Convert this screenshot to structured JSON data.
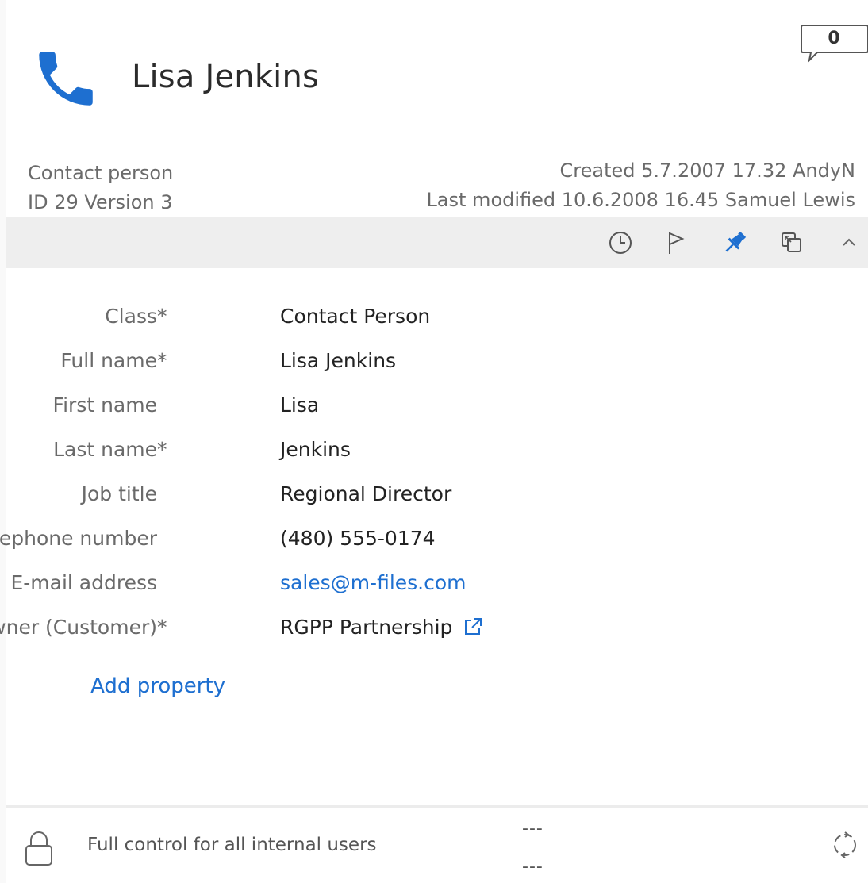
{
  "object": {
    "title": "Lisa Jenkins",
    "type_icon": "phone-icon",
    "type_label": "Contact person",
    "id_version": "ID 29  Version 3",
    "created": "Created 5.7.2007 17.32 AndyN",
    "modified": "Last modified 10.6.2008 16.45 Samuel Lewis",
    "comment_count": "0",
    "accent_color": "#1e6fd0"
  },
  "toolbar": {
    "icons": [
      "history-icon",
      "workflow-flag-icon",
      "pin-icon",
      "relationships-icon",
      "collapse-chevron-icon"
    ]
  },
  "properties": [
    {
      "label": "Class",
      "required": "*",
      "value": "Contact Person"
    },
    {
      "label": "Full name",
      "required": "*",
      "value": "Lisa Jenkins"
    },
    {
      "label": "First name",
      "required": "",
      "value": "Lisa"
    },
    {
      "label": "Last name",
      "required": "*",
      "value": "Jenkins"
    },
    {
      "label": "Job title",
      "required": "",
      "value": "Regional Director"
    },
    {
      "label": "Telephone number",
      "required": "",
      "value": "(480) 555-0174"
    },
    {
      "label": "E-mail address",
      "required": "",
      "value": "sales@m-files.com"
    },
    {
      "label": "Owner (Customer)",
      "required": "*",
      "value": "RGPP Partnership"
    }
  ],
  "add_property_label": "Add property",
  "footer": {
    "permissions": "Full control for all internal users",
    "dash_top": "---",
    "dash_bottom": "---"
  }
}
